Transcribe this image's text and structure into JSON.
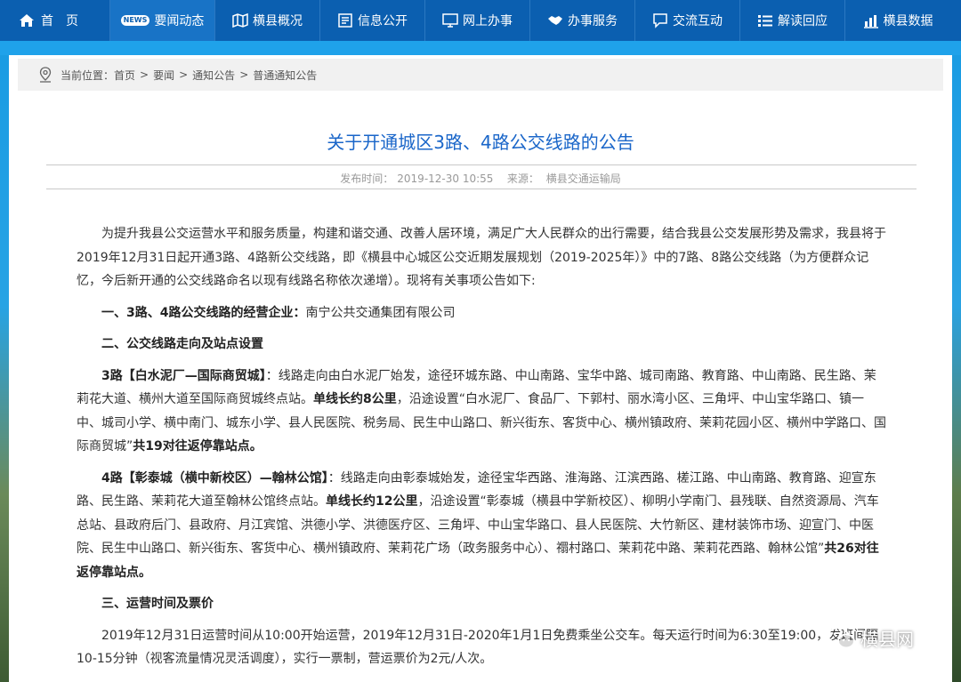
{
  "nav": {
    "items": [
      {
        "label": "首页",
        "icon": "home-icon"
      },
      {
        "label": "要闻动态",
        "icon": "news-icon",
        "badge": "NEWS",
        "active": true
      },
      {
        "label": "横县概况",
        "icon": "map-icon"
      },
      {
        "label": "信息公开",
        "icon": "document-icon"
      },
      {
        "label": "网上办事",
        "icon": "monitor-icon"
      },
      {
        "label": "办事服务",
        "icon": "handshake-icon"
      },
      {
        "label": "交流互动",
        "icon": "chat-icon"
      },
      {
        "label": "解读回应",
        "icon": "list-icon"
      },
      {
        "label": "横县数据",
        "icon": "chart-icon"
      }
    ]
  },
  "breadcrumb": {
    "label": "当前位置：",
    "items": [
      "首页",
      "要闻",
      "通知公告",
      "普通通知公告"
    ],
    "separator": ">"
  },
  "article": {
    "title": "关于开通城区3路、4路公交线路的公告",
    "publish_label": "发布时间：",
    "publish_time": "2019-12-30 10:55",
    "source_label": "来源：",
    "source": "横县交通运输局",
    "intro": "为提升我县公交运营水平和服务质量，构建和谐交通、改善人居环境，满足广大人民群众的出行需要，结合我县公交发展形势及需求，我县将于2019年12月31日起开通3路、4路新公交线路，即《横县中心城区公交近期发展规划（2019-2025年）》中的7路、8路公交线路（为方便群众记忆，今后新开通的公交线路命名以现有线路名称依次递增）。现将有关事项公告如下:",
    "s1_heading": "一、3路、4路公交线路的经营企业：",
    "s1_text": "南宁公共交通集团有限公司",
    "s2_heading": "二、公交线路走向及站点设置",
    "r3_name": "3路【白水泥厂—国际商贸城】",
    "r3_text1": "：线路走向由白水泥厂始发，途径环城东路、中山南路、宝华中路、城司南路、教育路、中山南路、民生路、茉莉花大道、横州大道至国际商贸城终点站。",
    "r3_length": "单线长约8公里",
    "r3_text2": "，沿途设置“白水泥厂、食品厂、下郭村、丽水湾小区、三角坪、中山宝华路口、镇一中、城司小学、横中南门、城东小学、县人民医院、税务局、民生中山路口、新兴街东、客货中心、横州镇政府、茉莉花园小区、横州中学路口、国际商贸城”",
    "r3_stops": "共19对往返停靠站点。",
    "r4_name": "4路【彰泰城（横中新校区）—翰林公馆】",
    "r4_text1": "：线路走向由彰泰城始发，途径宝华西路、淮海路、江滨西路、槎江路、中山南路、教育路、迎宣东路、民生路、茉莉花大道至翰林公馆终点站。",
    "r4_length": "单线长约12公里",
    "r4_text2": "，沿途设置“彰泰城（横县中学新校区）、柳明小学南门、县残联、自然资源局、汽车总站、县政府后门、县政府、月江宾馆、洪德小学、洪德医疗区、三角坪、中山宝华路口、县人民医院、大竹新区、建材装饰市场、迎宣门、中医院、民生中山路口、新兴街东、客货中心、横州镇政府、茉莉花广场（政务服务中心）、禤村路口、茉莉花中路、茉莉花西路、翰林公馆”",
    "r4_stops": "共26对往返停靠站点。",
    "s3_heading": "三、运营时间及票价",
    "s3_text": "2019年12月31日运营时间从10:00开始运营，2019年12月31日-2020年1月1日免费乘坐公交车。每天运行时间为6:30至19:00，发班间隔10-15分钟（视客流量情况灵活调度），实行一票制，营运票价为2元/人次。"
  },
  "watermark": {
    "text": "横县网",
    "icon": "wechat-logo-icon"
  },
  "colors": {
    "nav_bg": "#0b5fb0",
    "nav_active": "#1873c6",
    "title": "#1a66c9",
    "stripe": "#1fa2ea"
  }
}
